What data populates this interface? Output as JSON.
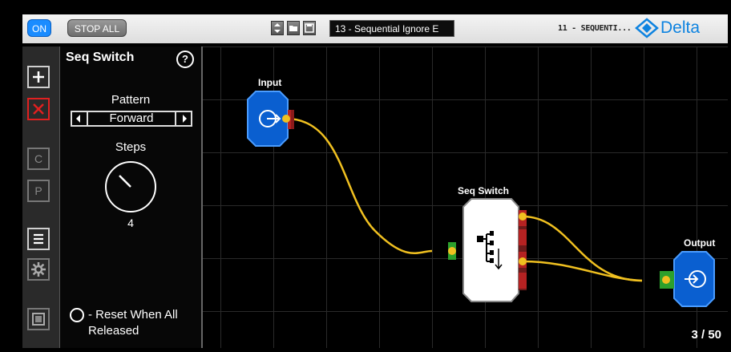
{
  "topbar": {
    "on_label": "ON",
    "stop_all_label": "STOP ALL",
    "preset_name": "13 - Sequential Ignore E",
    "preset_tag": "11 - SEQUENTI...",
    "brand": "Delta"
  },
  "module": {
    "title": "Seq Switch",
    "help_label": "?",
    "pattern_label": "Pattern",
    "pattern_value": "Forward",
    "steps_label": "Steps",
    "steps_value": "4",
    "reset_label": "- Reset When All Released"
  },
  "toolbar": {
    "copy_label": "C",
    "paste_label": "P"
  },
  "graph": {
    "nodes": {
      "input": "Input",
      "seq_switch": "Seq Switch",
      "output": "Output"
    },
    "page_counter": "3 / 50"
  },
  "colors": {
    "accent_blue": "#0a6be0",
    "cable": "#f0c020",
    "port_in": "#2ca02c",
    "port_out": "#b52222"
  }
}
